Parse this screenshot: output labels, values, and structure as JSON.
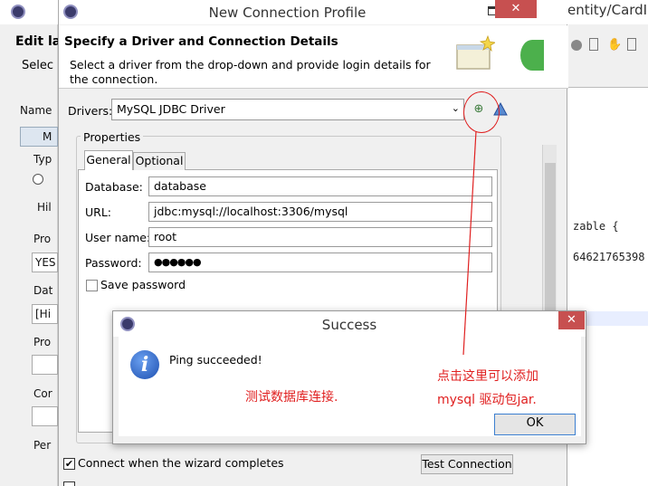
{
  "background_window": {
    "editor_tab": "entity/CardI",
    "edit_label": "Edit la",
    "select_label": "Selec",
    "left_items": [
      "Name",
      "M",
      "Typ",
      "C",
      "Hil",
      "Pro",
      "YES",
      "Dat",
      "[Hi",
      "Pro",
      "Cor",
      "Per"
    ],
    "code_lines": [
      "zable {",
      "64621765398"
    ]
  },
  "dialog": {
    "title": "New Connection Profile",
    "header_title": "Specify a Driver and Connection Details",
    "header_desc": "Select a driver from the drop-down and provide login details for the connection.",
    "drivers_label": "Drivers:",
    "drivers_value": "MySQL JDBC Driver",
    "properties_label": "Properties",
    "tab_general": "General",
    "tab_optional": "Optional",
    "fields": {
      "database_label": "Database:",
      "database_value": "database",
      "url_label": "URL:",
      "url_value": "jdbc:mysql://localhost:3306/mysql",
      "username_label": "User name:",
      "username_value": "root",
      "password_label": "Password:",
      "password_value": "●●●●●●"
    },
    "save_password_label": "Save password",
    "connect_when_complete_label": "Connect when the wizard completes",
    "connect_when_complete_checked": "✔",
    "test_connection_label": "Test Connection"
  },
  "success_dialog": {
    "title": "Success",
    "message": "Ping succeeded!",
    "ok_label": "OK",
    "close_symbol": "✕"
  },
  "annotations": {
    "test_note": "测试数据库连接.",
    "add_note_line1": "点击这里可以添加",
    "add_note_line2": "mysql 驱动包jar."
  },
  "colors": {
    "annotation_red": "#e02020",
    "close_red": "#c75050",
    "ok_border": "#3c7fd0"
  }
}
